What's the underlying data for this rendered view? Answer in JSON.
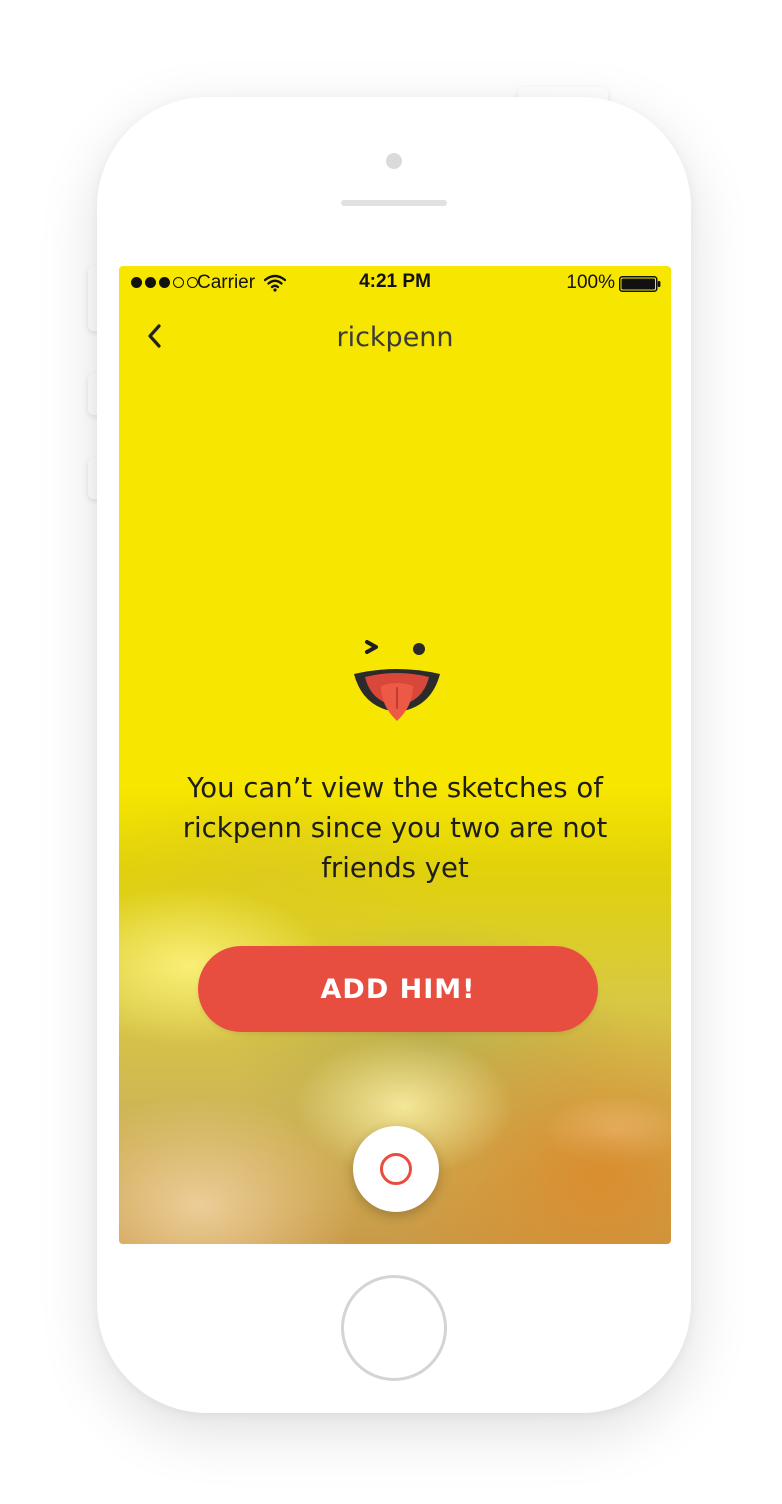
{
  "status_bar": {
    "carrier": "Carrier",
    "time": "4:21 PM",
    "battery": "100%",
    "signal_bars_filled": 3,
    "signal_bars_total": 5
  },
  "nav": {
    "title": "rickpenn",
    "back_icon": "chevron-left-icon"
  },
  "message": "You can’t view the sketches of rickpenn since you two are not friends yet",
  "add_button_label": "ADD HIM!",
  "record_button_icon": "record-circle-icon",
  "colors": {
    "screen_background": "#f7e600",
    "accent": "#e84e40"
  }
}
